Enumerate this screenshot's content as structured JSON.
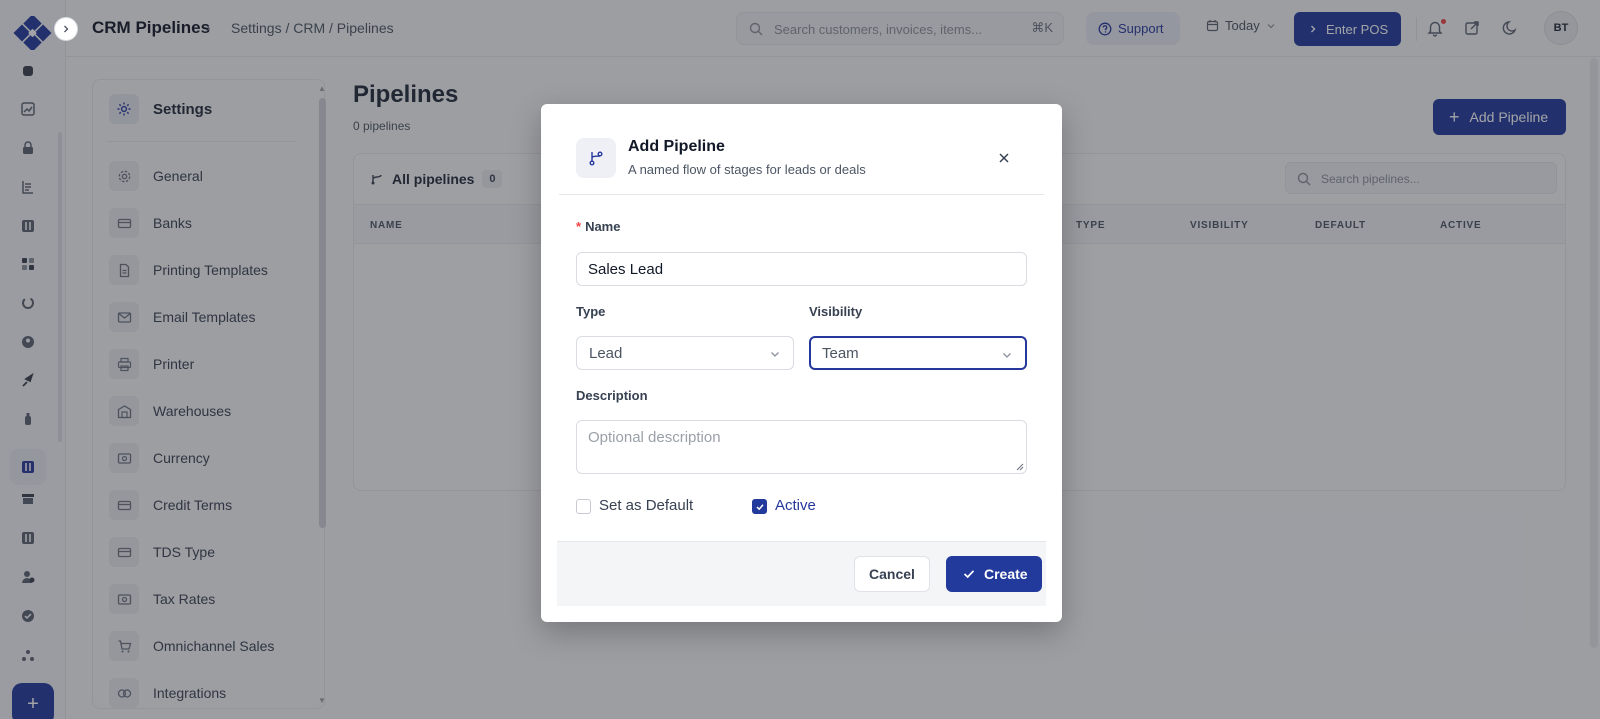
{
  "header": {
    "app_title": "CRM Pipelines",
    "breadcrumb": "Settings / CRM / Pipelines",
    "search_placeholder": "Search customers, invoices, items...",
    "search_shortcut": "⌘K",
    "support_label": "Support",
    "date_filter": "Today",
    "pos_label": "Enter POS",
    "avatar_initials": "BT"
  },
  "settings": {
    "title": "Settings",
    "items": [
      {
        "label": "General",
        "icon": "gear-icon"
      },
      {
        "label": "Banks",
        "icon": "card-icon"
      },
      {
        "label": "Printing Templates",
        "icon": "document-icon"
      },
      {
        "label": "Email Templates",
        "icon": "mail-icon"
      },
      {
        "label": "Printer",
        "icon": "printer-icon"
      },
      {
        "label": "Warehouses",
        "icon": "warehouse-icon"
      },
      {
        "label": "Currency",
        "icon": "currency-icon"
      },
      {
        "label": "Credit Terms",
        "icon": "card-icon"
      },
      {
        "label": "TDS Type",
        "icon": "card-icon"
      },
      {
        "label": "Tax Rates",
        "icon": "currency-icon"
      },
      {
        "label": "Omnichannel Sales",
        "icon": "cart-icon"
      },
      {
        "label": "Integrations",
        "icon": "link-icon"
      }
    ]
  },
  "main": {
    "title": "Pipelines",
    "subtitle": "0 pipelines",
    "add_button": "Add Pipeline",
    "card_title": "All pipelines",
    "count": "0",
    "search_placeholder": "Search pipelines...",
    "columns": [
      "NAME",
      "TYPE",
      "VISIBILITY",
      "DEFAULT",
      "ACTIVE"
    ]
  },
  "modal": {
    "title": "Add Pipeline",
    "subtitle": "A named flow of stages for leads or deals",
    "name_label": "Name",
    "name_value": "Sales Lead",
    "type_label": "Type",
    "type_value": "Lead",
    "visibility_label": "Visibility",
    "visibility_value": "Team",
    "description_label": "Description",
    "description_placeholder": "Optional description",
    "default_label": "Set as Default",
    "default_checked": false,
    "active_label": "Active",
    "active_checked": true,
    "cancel_label": "Cancel",
    "create_label": "Create"
  },
  "colors": {
    "accent": "#223a9b",
    "required": "#ef4444"
  }
}
